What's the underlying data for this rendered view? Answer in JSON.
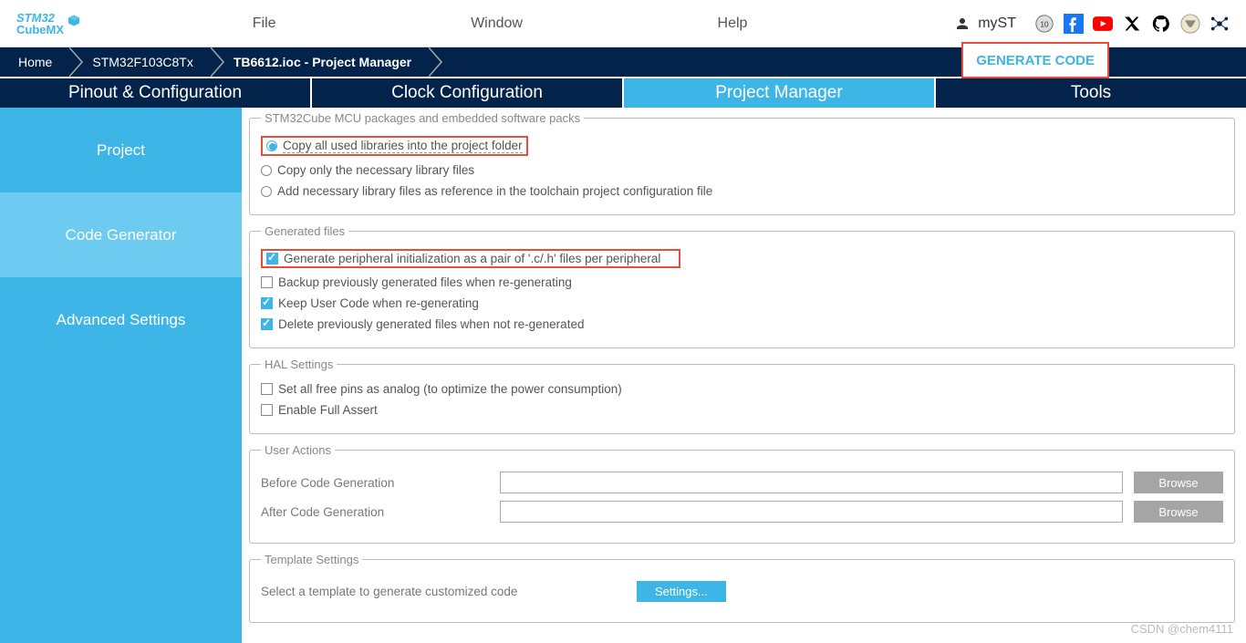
{
  "logo": {
    "line1": "STM32",
    "line2": "CubeMX"
  },
  "menu": {
    "file": "File",
    "window": "Window",
    "help": "Help",
    "myst": "mySt"
  },
  "myst_label": "myST",
  "breadcrumb": {
    "home": "Home",
    "chip": "STM32F103C8Tx",
    "active": "TB6612.ioc - Project Manager"
  },
  "generate_code": "GENERATE CODE",
  "tabs": {
    "pinout": "Pinout & Configuration",
    "clock": "Clock Configuration",
    "pm": "Project Manager",
    "tools": "Tools"
  },
  "sidebar": {
    "project": "Project",
    "codegen": "Code Generator",
    "advanced": "Advanced Settings"
  },
  "packages": {
    "legend": "STM32Cube MCU packages and embedded software packs",
    "opt1": "Copy all used libraries into the project folder",
    "opt2": "Copy only the necessary library files",
    "opt3": "Add necessary library files as reference in the toolchain project configuration file"
  },
  "genfiles": {
    "legend": "Generated files",
    "opt1": "Generate peripheral initialization as a pair of '.c/.h' files per peripheral",
    "opt2": "Backup previously generated files when re-generating",
    "opt3": "Keep User Code when re-generating",
    "opt4": "Delete previously generated files when not re-generated"
  },
  "hal": {
    "legend": "HAL Settings",
    "opt1": "Set all free pins as analog (to optimize the power consumption)",
    "opt2": "Enable Full Assert"
  },
  "actions": {
    "legend": "User Actions",
    "before": "Before Code Generation",
    "after": "After Code Generation",
    "browse": "Browse"
  },
  "template": {
    "legend": "Template Settings",
    "label": "Select a template to generate customized code",
    "settings": "Settings..."
  },
  "watermark": "CSDN @chem4111"
}
